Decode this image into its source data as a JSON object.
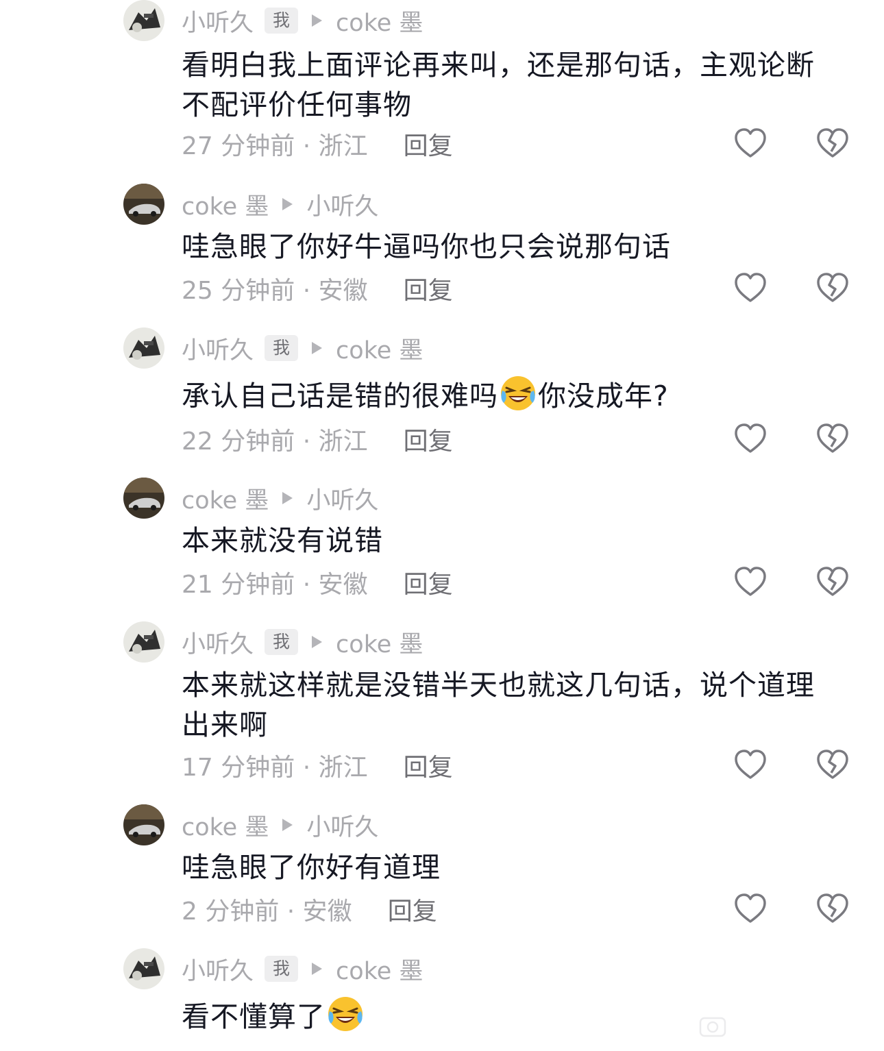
{
  "reply_label": "回复",
  "me_badge": "我",
  "comments": [
    {
      "author": "小听久",
      "is_me": true,
      "reply_to": "coke 墨",
      "text_lines": [
        "看明白我上面评论再来叫，还是那句话，主观论断",
        "不配评价任何事物"
      ],
      "emoji": "",
      "time_location": "27 分钟前 · 浙江"
    },
    {
      "author": "coke 墨",
      "is_me": false,
      "reply_to": "小听久",
      "text_lines": [
        "哇急眼了你好牛逼吗你也只会说那句话"
      ],
      "emoji": "",
      "time_location": "25 分钟前 · 安徽"
    },
    {
      "author": "小听久",
      "is_me": true,
      "reply_to": "coke 墨",
      "text_before": "承认自己话是错的很难吗",
      "emoji": "grinning-squinting-tears-emoji",
      "text_after": "你没成年?",
      "time_location": "22 分钟前 · 浙江"
    },
    {
      "author": "coke 墨",
      "is_me": false,
      "reply_to": "小听久",
      "text_lines": [
        "本来就没有说错"
      ],
      "emoji": "",
      "time_location": "21 分钟前 · 安徽"
    },
    {
      "author": "小听久",
      "is_me": true,
      "reply_to": "coke 墨",
      "text_lines": [
        "本来就这样就是没错半天也就这几句话，说个道理",
        "出来啊"
      ],
      "emoji": "",
      "time_location": "17 分钟前 · 浙江"
    },
    {
      "author": "coke 墨",
      "is_me": false,
      "reply_to": "小听久",
      "text_lines": [
        "哇急眼了你好有道理"
      ],
      "emoji": "",
      "time_location": "2 分钟前 · 安徽"
    },
    {
      "author": "小听久",
      "is_me": true,
      "reply_to": "coke 墨",
      "text_before": "看不懂算了",
      "emoji": "grinning-squinting-tears-emoji",
      "text_after": "",
      "time_location": ""
    }
  ],
  "colors": {
    "text": "#161823",
    "meta": "#a9a9ad",
    "reply": "#6f6f74",
    "icon_stroke": "#7a7a80",
    "emoji_face": "#f9c22e"
  }
}
